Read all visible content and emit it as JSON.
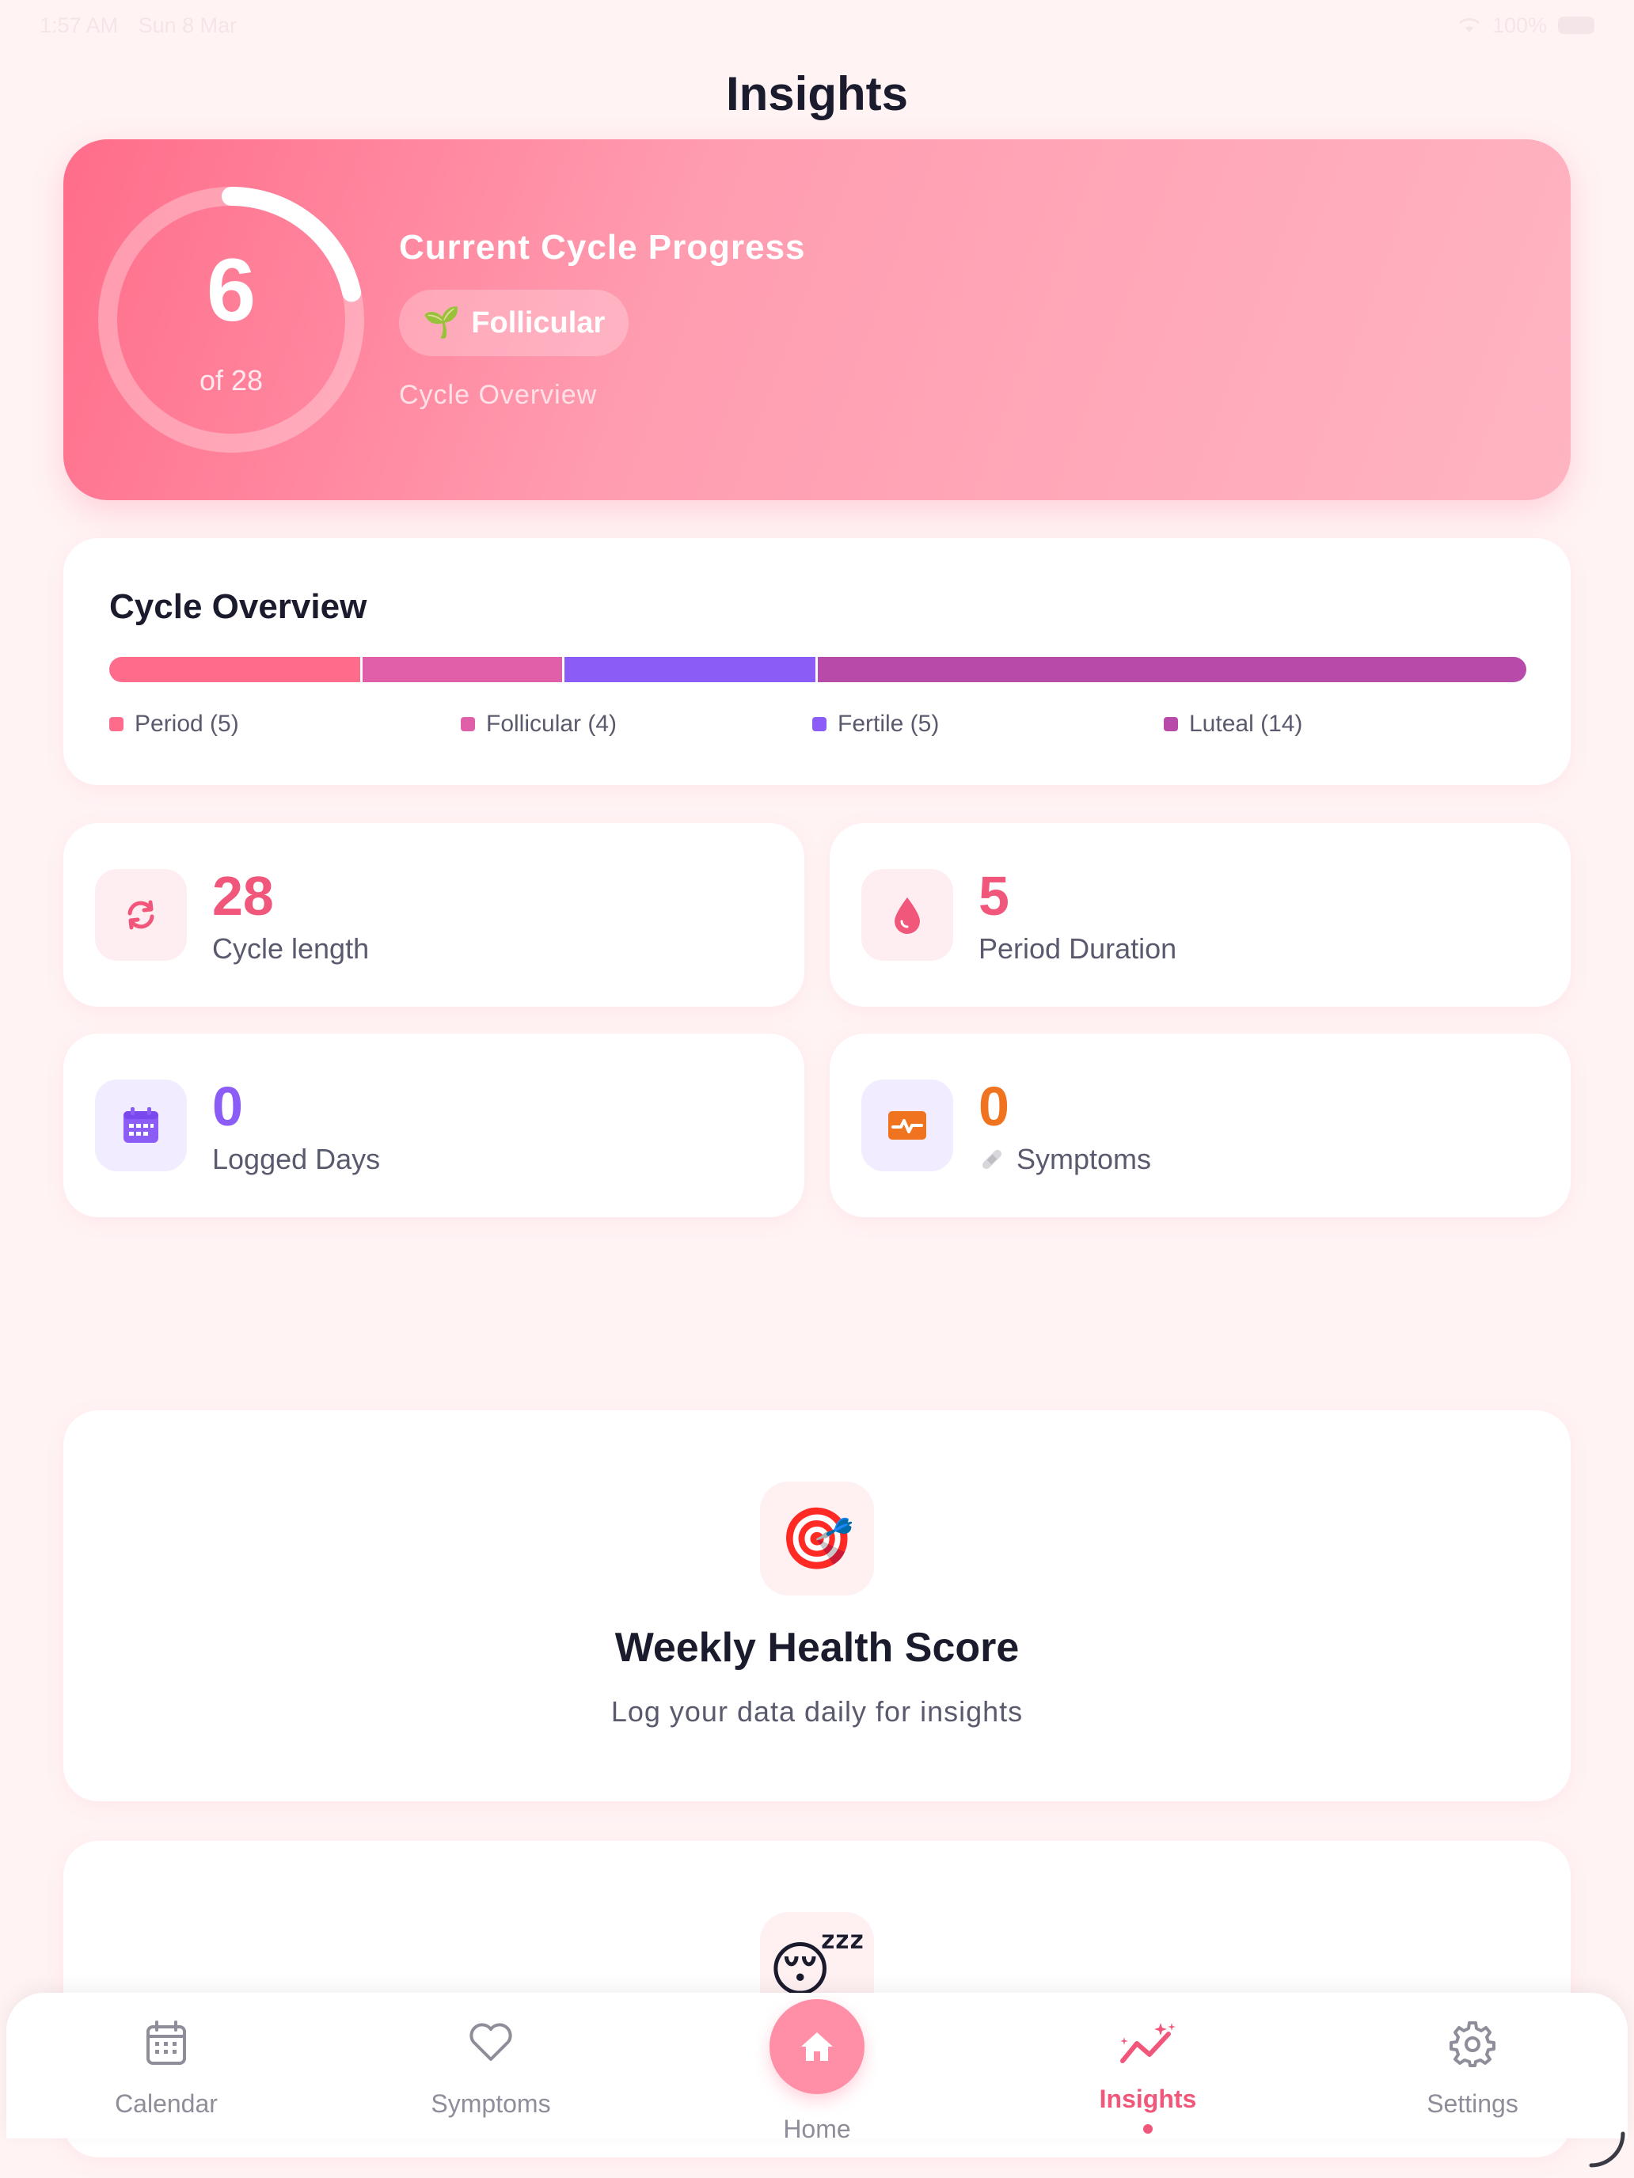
{
  "status_bar": {
    "time": "1:57 AM",
    "date": "Sun 8 Mar",
    "battery": "100%"
  },
  "header": {
    "title": "Insights"
  },
  "cycle_progress": {
    "current_day": "6",
    "total_label": "of 28",
    "progress_fraction": 0.2143,
    "title": "Current Cycle Progress",
    "phase_icon": "🌱",
    "phase": "Follicular",
    "link": "Cycle Overview"
  },
  "cycle_overview": {
    "title": "Cycle Overview",
    "phases": [
      {
        "label": "Period (5)",
        "days": 5,
        "color": "#FF6B8A"
      },
      {
        "label": "Follicular (4)",
        "days": 4,
        "color": "#DF60A8"
      },
      {
        "label": "Fertile (5)",
        "days": 5,
        "color": "#8B5CF6"
      },
      {
        "label": "Luteal (14)",
        "days": 14,
        "color": "#B84BAA"
      }
    ]
  },
  "stats": {
    "cycle_length": {
      "value": "28",
      "label": "Cycle length",
      "icon": "sync-icon",
      "color": "#F0577A"
    },
    "period_duration": {
      "value": "5",
      "label": "Period Duration",
      "icon": "drop-icon",
      "color": "#F0577A"
    },
    "logged_days": {
      "value": "0",
      "label": "Logged Days",
      "icon": "calendar-icon",
      "color": "#8B5CF6"
    },
    "symptoms": {
      "value": "0",
      "label": "Symptoms",
      "icon": "pulse-icon",
      "color": "#F0731F"
    }
  },
  "health_score": {
    "emoji": "🎯",
    "title": "Weekly Health Score",
    "subtitle": "Log your data daily for insights"
  },
  "sleep_card": {
    "emoji": "😴"
  },
  "tab_bar": {
    "calendar": "Calendar",
    "symptoms": "Symptoms",
    "home": "Home",
    "insights": "Insights",
    "settings": "Settings",
    "active": "insights"
  }
}
